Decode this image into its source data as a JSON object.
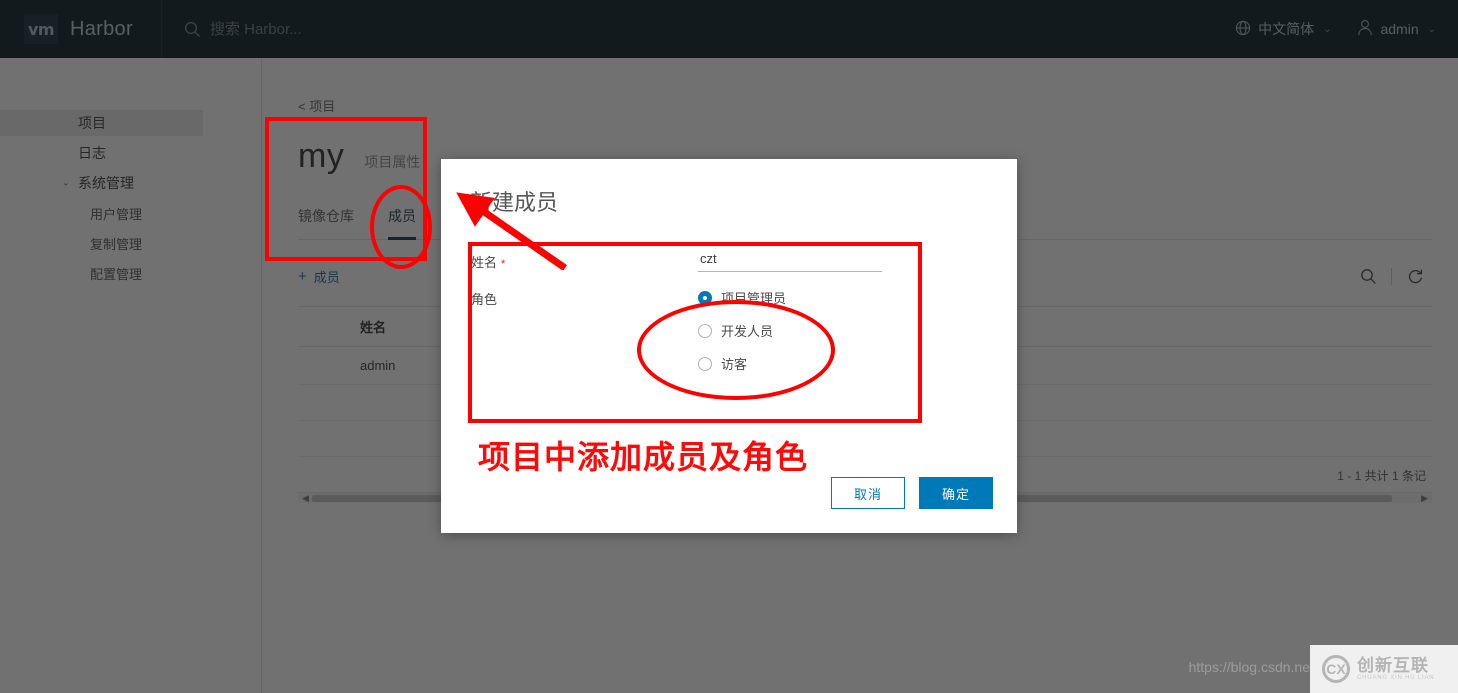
{
  "header": {
    "logo_text": "vm",
    "brand": "Harbor",
    "search_placeholder": "搜索 Harbor...",
    "language": "中文简体",
    "user": "admin",
    "caret": "⌄"
  },
  "sidebar": {
    "items": [
      {
        "label": "项目",
        "level": 0,
        "active": true,
        "chevron": ""
      },
      {
        "label": "日志",
        "level": 0,
        "active": false,
        "chevron": ""
      },
      {
        "label": "系统管理",
        "level": 0,
        "active": false,
        "chevron": "⌄"
      },
      {
        "label": "用户管理",
        "level": 1,
        "active": false,
        "chevron": ""
      },
      {
        "label": "复制管理",
        "level": 1,
        "active": false,
        "chevron": ""
      },
      {
        "label": "配置管理",
        "level": 1,
        "active": false,
        "chevron": ""
      }
    ]
  },
  "main": {
    "breadcrumb": "< 项目",
    "project_title": "my",
    "project_subtitle": "项目属性",
    "tabs": [
      {
        "label": "镜像仓库",
        "active": false
      },
      {
        "label": "成员",
        "active": true
      }
    ],
    "add_button": "成员",
    "add_plus": "+",
    "table": {
      "columns": [
        "姓名"
      ],
      "rows": [
        [
          "admin"
        ]
      ]
    },
    "pagination": "1 - 1 共计 1 条记"
  },
  "modal": {
    "title": "新建成员",
    "name_label": "姓名",
    "required_mark": "*",
    "name_value": "czt",
    "name_placeholder": "",
    "role_label": "角色",
    "roles": [
      {
        "label": "项目管理员",
        "selected": true
      },
      {
        "label": "开发人员",
        "selected": false
      },
      {
        "label": "访客",
        "selected": false
      }
    ],
    "cancel_label": "取消",
    "confirm_label": "确定"
  },
  "annotations": {
    "caption": "项目中添加成员及角色",
    "color": "#ff0000"
  },
  "watermark": {
    "url": "https://blog.csdn.ne",
    "logo_cn": "创新互联",
    "logo_en": "CHUANG XIN HU LIAN",
    "logo_mark": "CX"
  },
  "colors": {
    "header_bg": "#2c3a44",
    "accent": "#0079b8",
    "tab_active": "#37505e",
    "annotation_red": "#ff0000"
  }
}
